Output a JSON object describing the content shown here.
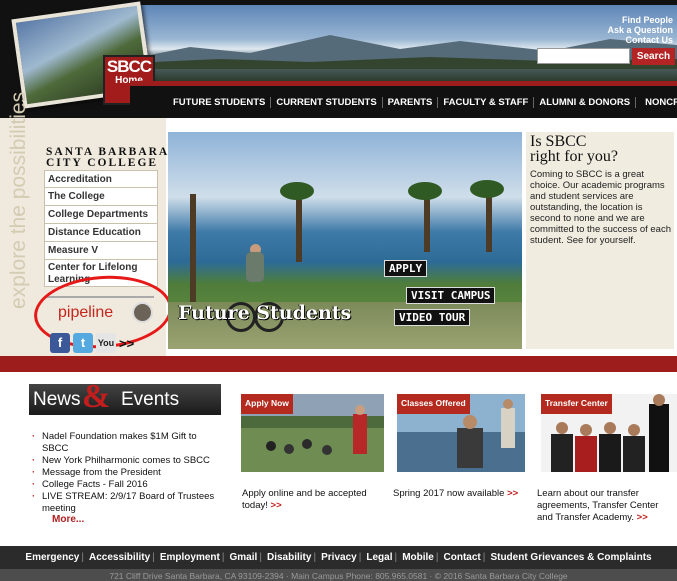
{
  "header": {
    "logo_text": "SBCC",
    "logo_home": "Home",
    "utility_links": [
      "Find People",
      "Ask a Question",
      "Contact Us"
    ],
    "search": {
      "placeholder": "",
      "button_label": "Search"
    },
    "nav": [
      "FUTURE STUDENTS",
      "CURRENT STUDENTS",
      "PARENTS",
      "FACULTY & STAFF",
      "ALUMNI & DONORS",
      "NONCREDIT"
    ]
  },
  "sidebar": {
    "tagline": "explore the possibilities",
    "college_line1": "SANTA BARBARA",
    "college_line2": "CITY COLLEGE",
    "links": [
      "Accreditation",
      "The College",
      "College Departments",
      "Distance Education",
      "Measure V",
      "Center for Lifelong Learning"
    ],
    "pipeline_label": "pipeline",
    "social": {
      "facebook": "f",
      "twitter": "t",
      "youtube": "You",
      "more": ">>"
    }
  },
  "hero": {
    "apply": "APPLY",
    "visit_campus": "VISIT CAMPUS",
    "video_tour": "VIDEO TOUR",
    "caption": "Future Students"
  },
  "blurb": {
    "title_line1": "Is SBCC",
    "title_line2": "right for you?",
    "body": "Coming to SBCC is a great choice. Our academic programs and student services are outstanding, the location is second to none and we are committed to the success of each student. See for yourself."
  },
  "news": {
    "title_left": "News",
    "amp": "&",
    "title_right": "Events",
    "items": [
      "Nadel Foundation makes $1M Gift to SBCC",
      "New York Philharmonic comes to SBCC",
      "Message from the President",
      "College Facts - Fall 2016",
      "LIVE STREAM: 2/9/17 Board of Trustees meeting"
    ],
    "more": "More..."
  },
  "promos": [
    {
      "label": "Apply Now",
      "text": "Apply online and be accepted today!",
      "arrow": ">>"
    },
    {
      "label": "Classes Offered",
      "text": "Spring 2017 now available",
      "arrow": ">>"
    },
    {
      "label": "Transfer Center",
      "text": "Learn about our transfer agreements, Transfer Center and Transfer Academy.",
      "arrow": ">>"
    }
  ],
  "footer": {
    "links": [
      "Emergency",
      "Accessibility",
      "Employment",
      "Gmail",
      "Disability",
      "Privacy",
      "Legal",
      "Mobile",
      "Contact",
      "Student Grievances & Complaints"
    ],
    "address": "721 Cliff Drive Santa Barbara, CA 93109-2394 · Main Campus Phone: 805.965.0581 · © 2016 Santa Barbara City College"
  },
  "colors": {
    "brand_red": "#9d1d1d",
    "annotation_circle": "#e61919",
    "nav_bg": "#111111"
  }
}
